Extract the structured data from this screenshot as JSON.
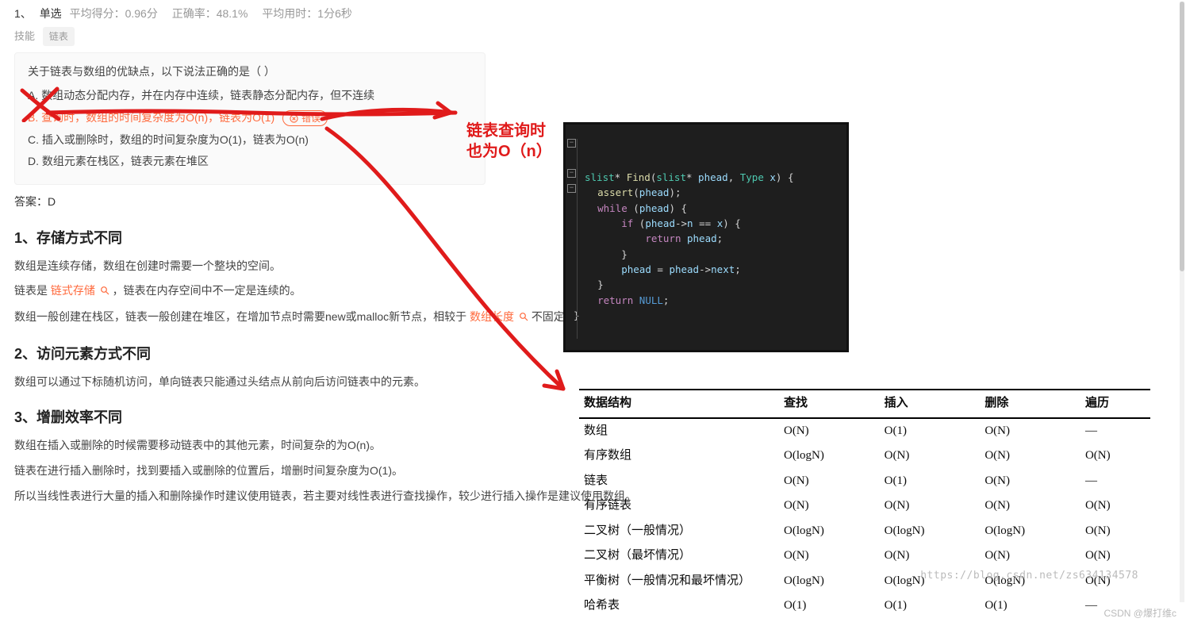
{
  "meta": {
    "q_index": "1、",
    "q_type": "单选",
    "avg_score": "平均得分：0.96分",
    "accuracy": "正确率：48.1%",
    "avg_time": "平均用时：1分6秒"
  },
  "skill": {
    "label": "技能",
    "tag": "链表"
  },
  "question": {
    "stem": "关于链表与数组的优缺点，以下说法正确的是（ ）",
    "opt_a": "A. 数组动态分配内存，并在内存中连续，链表静态分配内存，但不连续",
    "opt_b": "B. 查询时，数组的时间复杂度为O(n)，链表为O(1)",
    "opt_c": "C. 插入或删除时，数组的时间复杂度为O(1)，链表为O(n)",
    "opt_d": "D. 数组元素在栈区，链表元素在堆区",
    "error_badge": "错误"
  },
  "answer": {
    "text": "答案：D"
  },
  "sections": {
    "s1_title": "1、存储方式不同",
    "s1_p1": "数组是连续存储，数组在创建时需要一个整块的空间。",
    "s1_p2a": "链表是 ",
    "s1_p2_hl": "链式存储",
    "s1_p2b": "，链表在内存空间中不一定是连续的。",
    "s1_p3a": "数组一般创建在栈区，链表一般创建在堆区，在增加节点时需要new或malloc新节点，相较于 ",
    "s1_p3_hl": "数组长度",
    "s1_p3b": " 不固定，自由度高。",
    "s2_title": "2、访问元素方式不同",
    "s2_p1": "数组可以通过下标随机访问，单向链表只能通过头结点从前向后访问链表中的元素。",
    "s3_title": "3、增删效率不同",
    "s3_p1": "数组在插入或删除的时候需要移动链表中的其他元素，时间复杂的为O(n)。",
    "s3_p2": "链表在进行插入删除时，找到要插入或删除的位置后，增删时间复杂度为O(1)。",
    "s3_p3": "所以当线性表进行大量的插入和删除操作时建议使用链表，若主要对线性表进行查找操作，较少进行插入操作是建议使用数组。"
  },
  "annotation": {
    "line1": "链表查询时",
    "line2": "也为O（n）"
  },
  "code_lines": [
    "slist* Find(slist* phead, Type x) {",
    "    assert(phead);",
    "    while (phead) {",
    "        if (phead->n == x) {",
    "            return phead;",
    "        }",
    "        phead = phead->next;",
    "    }",
    "    return NULL;",
    "}"
  ],
  "table": {
    "headers": [
      "数据结构",
      "查找",
      "插入",
      "删除",
      "遍历"
    ],
    "rows": [
      [
        "数组",
        "O(N)",
        "O(1)",
        "O(N)",
        "—"
      ],
      [
        "有序数组",
        "O(logN)",
        "O(N)",
        "O(N)",
        "O(N)"
      ],
      [
        "链表",
        "O(N)",
        "O(1)",
        "O(N)",
        "—"
      ],
      [
        "有序链表",
        "O(N)",
        "O(N)",
        "O(N)",
        "O(N)"
      ],
      [
        "二叉树（一般情况）",
        "O(logN)",
        "O(logN)",
        "O(logN)",
        "O(N)"
      ],
      [
        "二叉树（最坏情况）",
        "O(N)",
        "O(N)",
        "O(N)",
        "O(N)"
      ],
      [
        "平衡树（一般情况和最坏情况）",
        "O(logN)",
        "O(logN)",
        "O(logN)",
        "O(N)"
      ],
      [
        "哈希表",
        "O(1)",
        "O(1)",
        "O(1)",
        "—"
      ]
    ]
  },
  "watermarks": {
    "a": "https://blog.csdn.net/zs634134578",
    "b": "CSDN @爆打维c"
  }
}
